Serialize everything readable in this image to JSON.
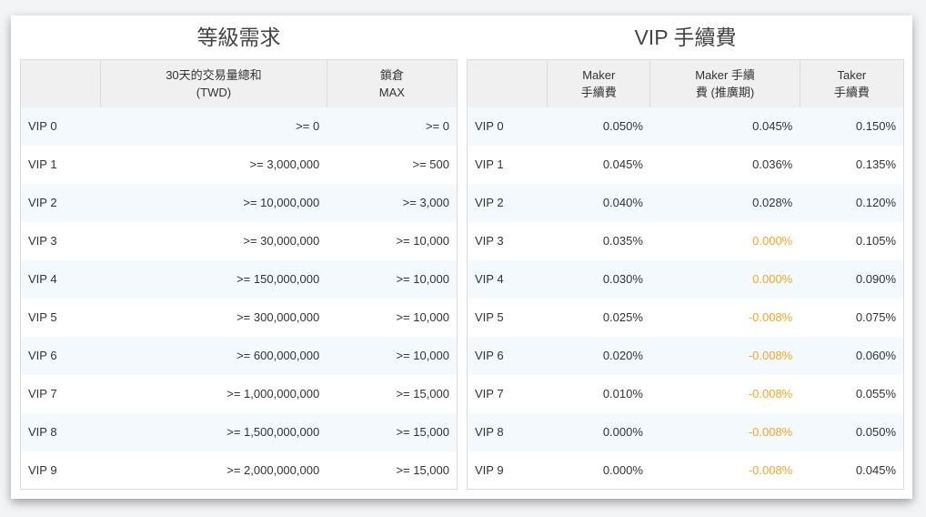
{
  "left_panel": {
    "title": "等級需求",
    "headers": [
      "",
      "30天的交易量總和\n(TWD)",
      "鎖倉\nMAX"
    ],
    "rows": [
      {
        "level": "VIP 0",
        "volume": ">= 0",
        "lock": ">= 0"
      },
      {
        "level": "VIP 1",
        "volume": ">= 3,000,000",
        "lock": ">= 500"
      },
      {
        "level": "VIP 2",
        "volume": ">= 10,000,000",
        "lock": ">= 3,000"
      },
      {
        "level": "VIP 3",
        "volume": ">= 30,000,000",
        "lock": ">= 10,000"
      },
      {
        "level": "VIP 4",
        "volume": ">= 150,000,000",
        "lock": ">= 10,000"
      },
      {
        "level": "VIP 5",
        "volume": ">= 300,000,000",
        "lock": ">= 10,000"
      },
      {
        "level": "VIP 6",
        "volume": ">= 600,000,000",
        "lock": ">= 10,000"
      },
      {
        "level": "VIP 7",
        "volume": ">= 1,000,000,000",
        "lock": ">= 15,000"
      },
      {
        "level": "VIP 8",
        "volume": ">= 1,500,000,000",
        "lock": ">= 15,000"
      },
      {
        "level": "VIP 9",
        "volume": ">= 2,000,000,000",
        "lock": ">= 15,000"
      }
    ]
  },
  "right_panel": {
    "title": "VIP 手續費",
    "headers": [
      "",
      "Maker\n手續費",
      "Maker 手續\n費 (推廣期)",
      "Taker\n手續費"
    ],
    "rows": [
      {
        "level": "VIP 0",
        "maker": "0.050%",
        "maker_promo": "0.045%",
        "maker_promo_highlight": false,
        "taker": "0.150%"
      },
      {
        "level": "VIP 1",
        "maker": "0.045%",
        "maker_promo": "0.036%",
        "maker_promo_highlight": false,
        "taker": "0.135%"
      },
      {
        "level": "VIP 2",
        "maker": "0.040%",
        "maker_promo": "0.028%",
        "maker_promo_highlight": false,
        "taker": "0.120%"
      },
      {
        "level": "VIP 3",
        "maker": "0.035%",
        "maker_promo": "0.000%",
        "maker_promo_highlight": true,
        "taker": "0.105%"
      },
      {
        "level": "VIP 4",
        "maker": "0.030%",
        "maker_promo": "0.000%",
        "maker_promo_highlight": true,
        "taker": "0.090%"
      },
      {
        "level": "VIP 5",
        "maker": "0.025%",
        "maker_promo": "-0.008%",
        "maker_promo_highlight": true,
        "taker": "0.075%"
      },
      {
        "level": "VIP 6",
        "maker": "0.020%",
        "maker_promo": "-0.008%",
        "maker_promo_highlight": true,
        "taker": "0.060%"
      },
      {
        "level": "VIP 7",
        "maker": "0.010%",
        "maker_promo": "-0.008%",
        "maker_promo_highlight": true,
        "taker": "0.055%"
      },
      {
        "level": "VIP 8",
        "maker": "0.000%",
        "maker_promo": "-0.008%",
        "maker_promo_highlight": true,
        "taker": "0.050%"
      },
      {
        "level": "VIP 9",
        "maker": "0.000%",
        "maker_promo": "-0.008%",
        "maker_promo_highlight": true,
        "taker": "0.045%"
      }
    ]
  },
  "colors": {
    "promo_highlight": "#f5a623",
    "row_stripe": "#f3f9fd",
    "header_bg": "#f0f0f0",
    "text": "#333333"
  }
}
